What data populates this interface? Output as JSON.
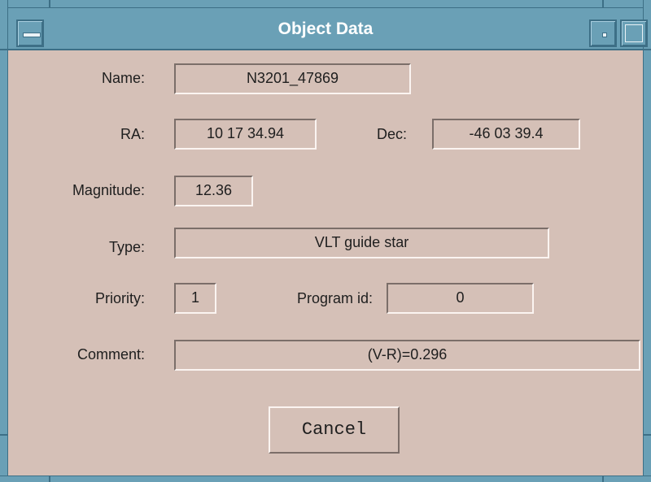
{
  "window": {
    "title": "Object Data"
  },
  "icons": {
    "window_menu": "window-menu-icon",
    "minimize": "minimize-icon",
    "maximize": "maximize-icon"
  },
  "colors": {
    "title_bar": "#6aa0b6",
    "background": "#d5c0b7",
    "title_text": "#ffffff"
  },
  "form": {
    "name": {
      "label": "Name:",
      "value": "N3201_47869"
    },
    "ra": {
      "label": "RA:",
      "value": "10 17 34.94"
    },
    "dec": {
      "label": "Dec:",
      "value": "-46 03 39.4"
    },
    "magnitude": {
      "label": "Magnitude:",
      "value": "12.36"
    },
    "type": {
      "label": "Type:",
      "value": "VLT guide star"
    },
    "priority": {
      "label": "Priority:",
      "value": "1"
    },
    "program_id": {
      "label": "Program id:",
      "value": "0"
    },
    "comment": {
      "label": "Comment:",
      "value": "(V-R)=0.296"
    }
  },
  "buttons": {
    "cancel": "Cancel"
  }
}
